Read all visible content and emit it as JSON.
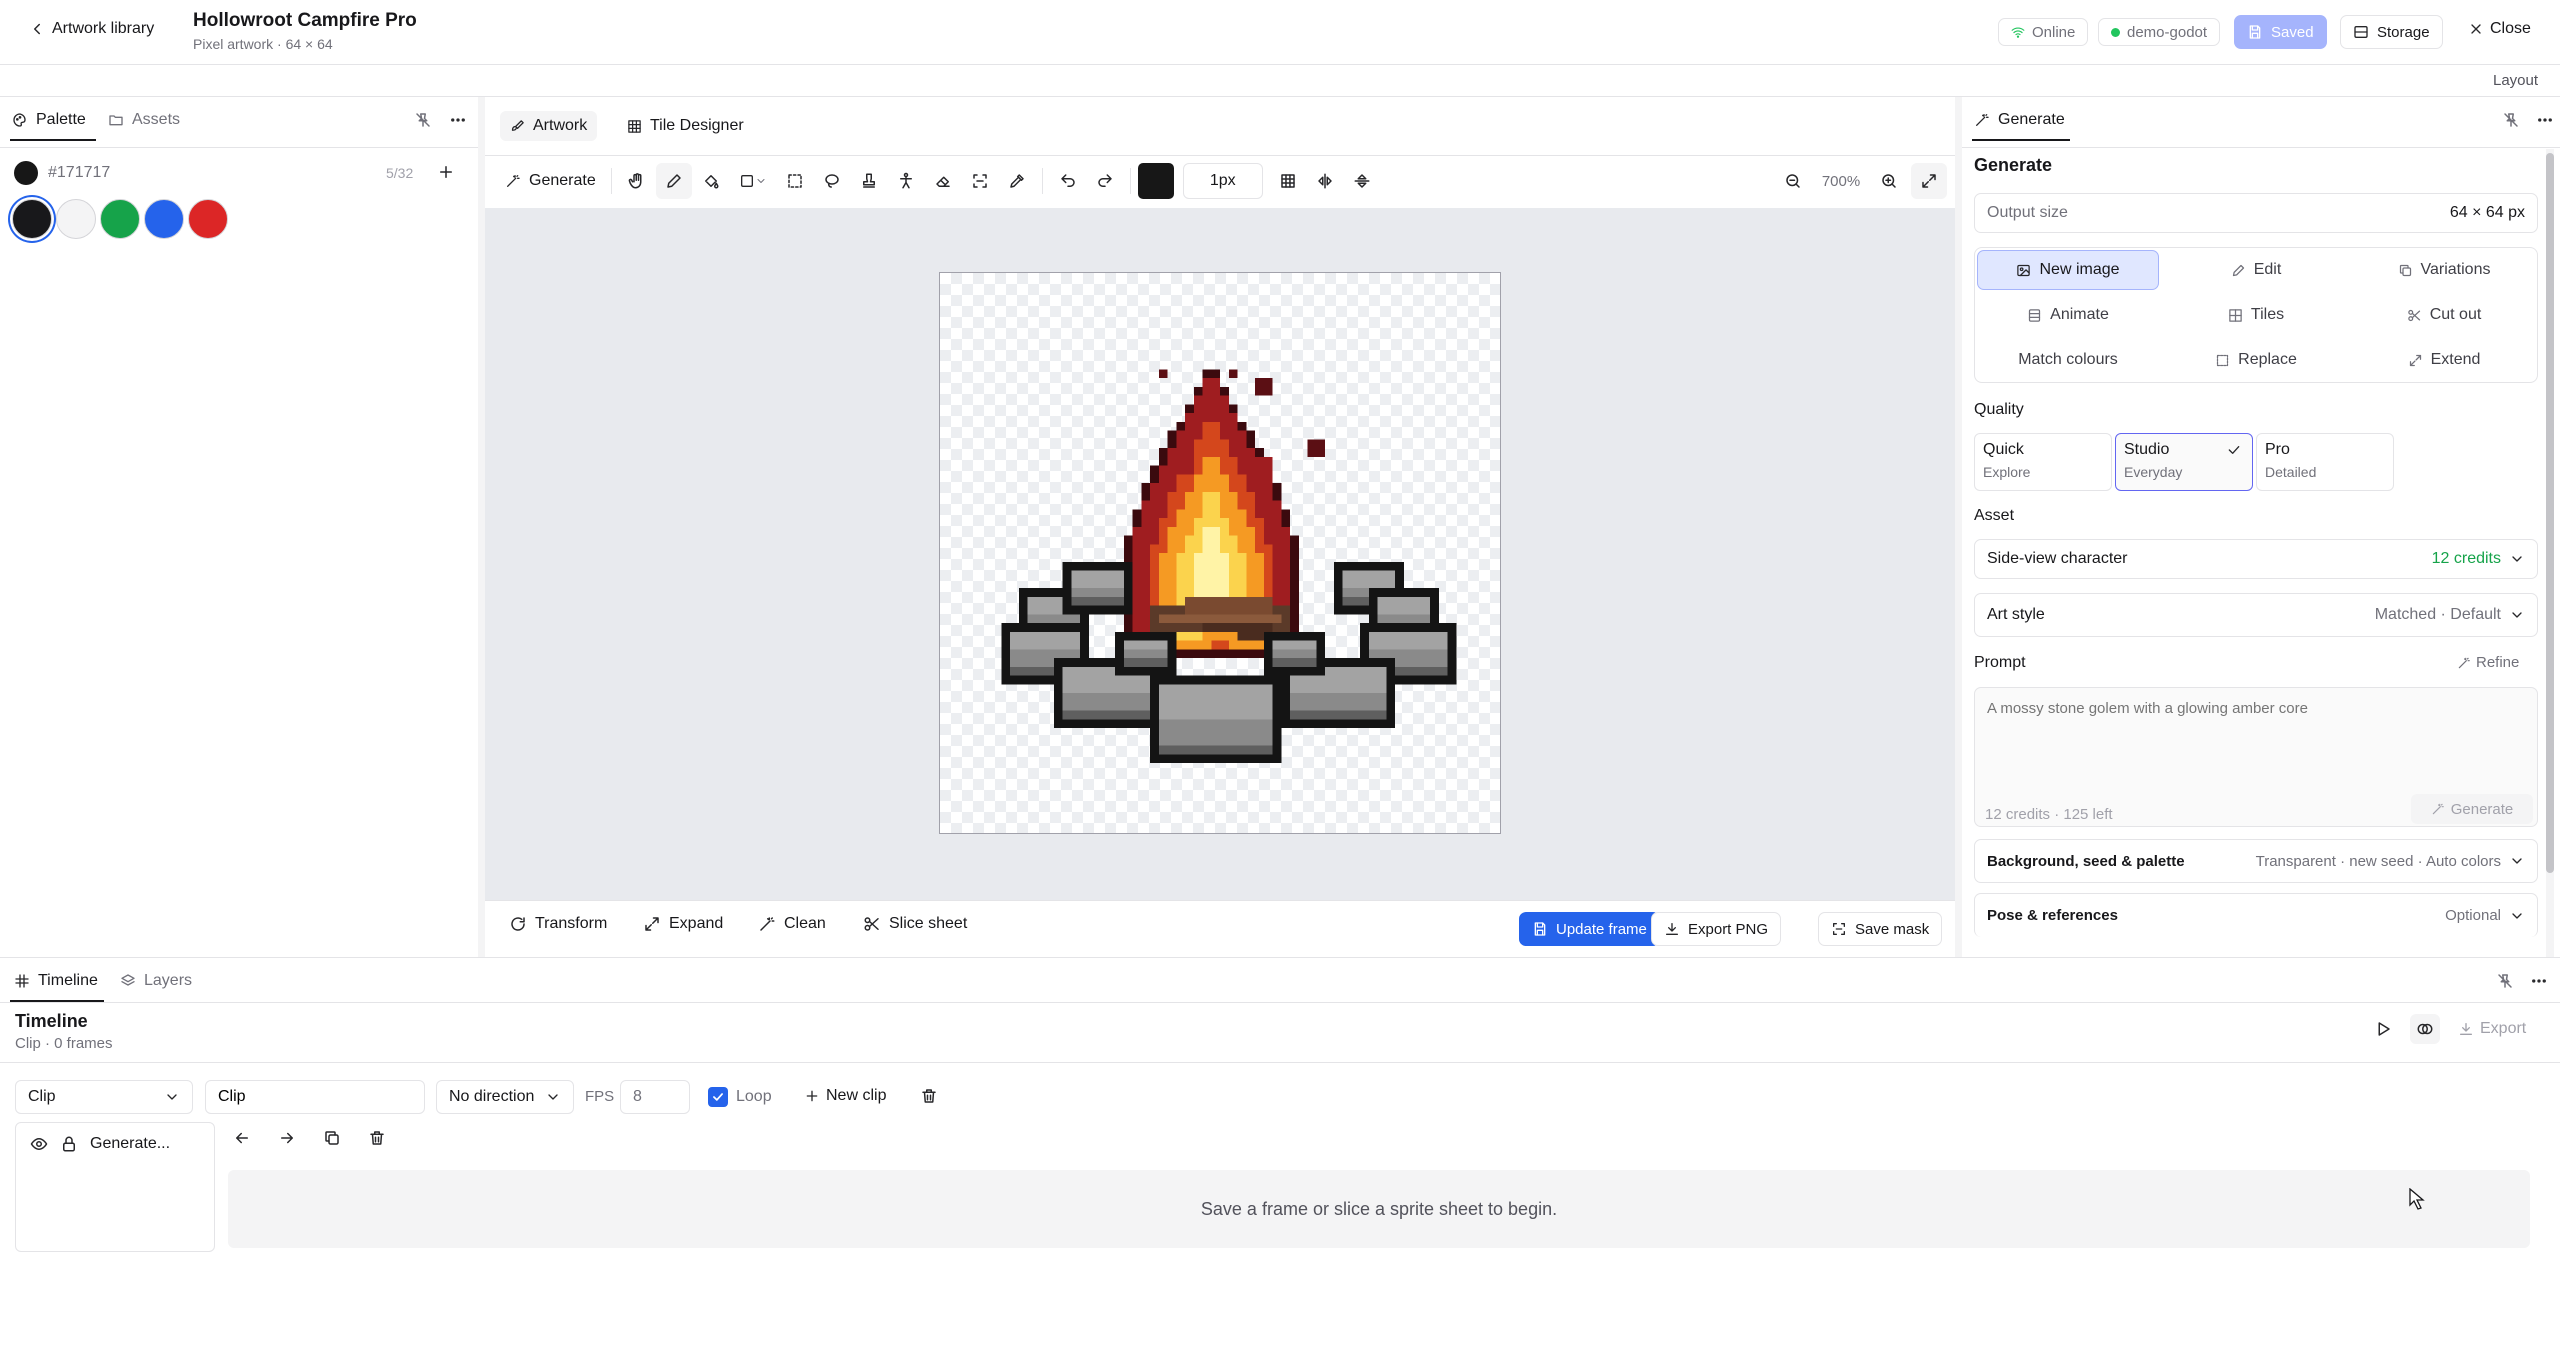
{
  "header": {
    "back_label": "Artwork library",
    "title": "Hollowroot Campfire Pro",
    "subtitle": "Pixel artwork · 64 × 64",
    "status_online": "Online",
    "project": "demo-godot",
    "saved_label": "Saved",
    "storage_label": "Storage",
    "close_label": "Close"
  },
  "layout_label": "Layout",
  "left_panel": {
    "tabs": [
      {
        "label": "Palette",
        "icon": "palette-icon"
      },
      {
        "label": "Assets",
        "icon": "folder-icon"
      }
    ],
    "current_color": "#171717",
    "count": "5/32",
    "swatches": [
      "#18181b",
      "#f4f4f5",
      "#16a34a",
      "#2563eb",
      "#dc2626"
    ]
  },
  "editor": {
    "tabs": [
      {
        "label": "Artwork"
      },
      {
        "label": "Tile Designer"
      }
    ],
    "generate_label": "Generate",
    "brush_size": "1px",
    "zoom": "700%",
    "bottom": {
      "transform": "Transform",
      "expand": "Expand",
      "clean": "Clean",
      "slice": "Slice sheet",
      "update": "Update frame",
      "export": "Export PNG",
      "save_mask": "Save mask"
    }
  },
  "generate_panel": {
    "tab_label": "Generate",
    "heading": "Generate",
    "output_size_label": "Output size",
    "output_size_value": "64 × 64 px",
    "modes": [
      {
        "label": "New image",
        "icon": "image-icon",
        "active": true
      },
      {
        "label": "Edit",
        "icon": "pencil-icon",
        "active": false
      },
      {
        "label": "Variations",
        "icon": "copy-icon",
        "active": false
      },
      {
        "label": "Animate",
        "icon": "film-icon",
        "active": false
      },
      {
        "label": "Tiles",
        "icon": "grid-icon",
        "active": false
      },
      {
        "label": "Cut out",
        "icon": "scissors-icon",
        "active": false
      },
      {
        "label": "Match colours",
        "icon": "",
        "active": false
      },
      {
        "label": "Replace",
        "icon": "replace-icon",
        "active": false
      },
      {
        "label": "Extend",
        "icon": "expand-icon",
        "active": false
      }
    ],
    "quality_label": "Quality",
    "quality": [
      {
        "title": "Quick",
        "sub": "Explore",
        "selected": false
      },
      {
        "title": "Studio",
        "sub": "Everyday",
        "selected": true
      },
      {
        "title": "Pro",
        "sub": "Detailed",
        "selected": false
      }
    ],
    "asset_label": "Asset",
    "asset_value": "Side-view character",
    "asset_credits": "12 credits",
    "art_style_label": "Art style",
    "art_style_value": "Matched · Default",
    "prompt_label": "Prompt",
    "refine_label": "Refine",
    "prompt_placeholder": "A mossy stone golem with a glowing amber core",
    "credits_info": "12 credits · 125 left",
    "generate_button": "Generate",
    "background_label": "Background, seed & palette",
    "background_value": "Transparent · new seed · Auto colors",
    "pose_label": "Pose & references",
    "pose_value": "Optional"
  },
  "timeline": {
    "tabs": [
      {
        "label": "Timeline"
      },
      {
        "label": "Layers"
      }
    ],
    "heading": "Timeline",
    "sub": "Clip · 0 frames",
    "export_label": "Export",
    "clip_select": "Clip",
    "clip_name": "Clip",
    "direction": "No direction",
    "fps_label": "FPS",
    "fps_value": "8",
    "loop_label": "Loop",
    "new_clip": "New clip",
    "layer_name": "Generate...",
    "empty_message": "Save a frame or slice a sprite sheet to begin."
  }
}
